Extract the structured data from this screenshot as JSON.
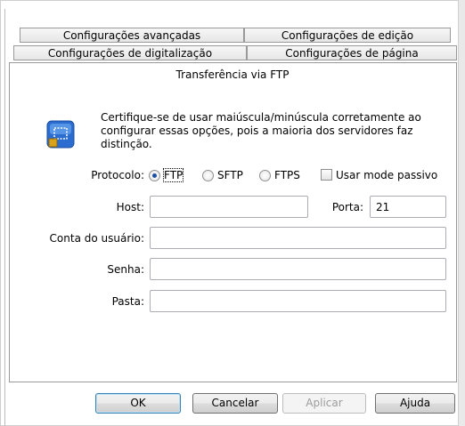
{
  "tabs": {
    "row1": [
      "Configurações avançadas",
      "Configurações de edição"
    ],
    "row2": [
      "Configurações de digitalização",
      "Configurações de página"
    ]
  },
  "panel": {
    "title": "Transferência via FTP",
    "info_text": "Certifique-se de usar maiúscula/minúscula corretamente ao configurar essas opções, pois a maioria dos servidores faz distinção."
  },
  "protocol": {
    "label": "Protocolo:",
    "options": [
      "FTP",
      "SFTP",
      "FTPS"
    ],
    "selected": "FTP",
    "passive_label": "Usar mode passivo",
    "passive_checked": false
  },
  "fields": {
    "host_label": "Host:",
    "host_value": "",
    "port_label": "Porta:",
    "port_value": "21",
    "user_label": "Conta do usuário:",
    "user_value": "",
    "password_label": "Senha:",
    "password_value": "",
    "folder_label": "Pasta:",
    "folder_value": ""
  },
  "buttons": {
    "ok": "OK",
    "cancel": "Cancelar",
    "apply": "Aplicar",
    "help": "Ajuda"
  },
  "colors": {
    "accent": "#1d4fa0",
    "icon_blue": "#2b6cd0",
    "icon_gold": "#d9a21b"
  }
}
